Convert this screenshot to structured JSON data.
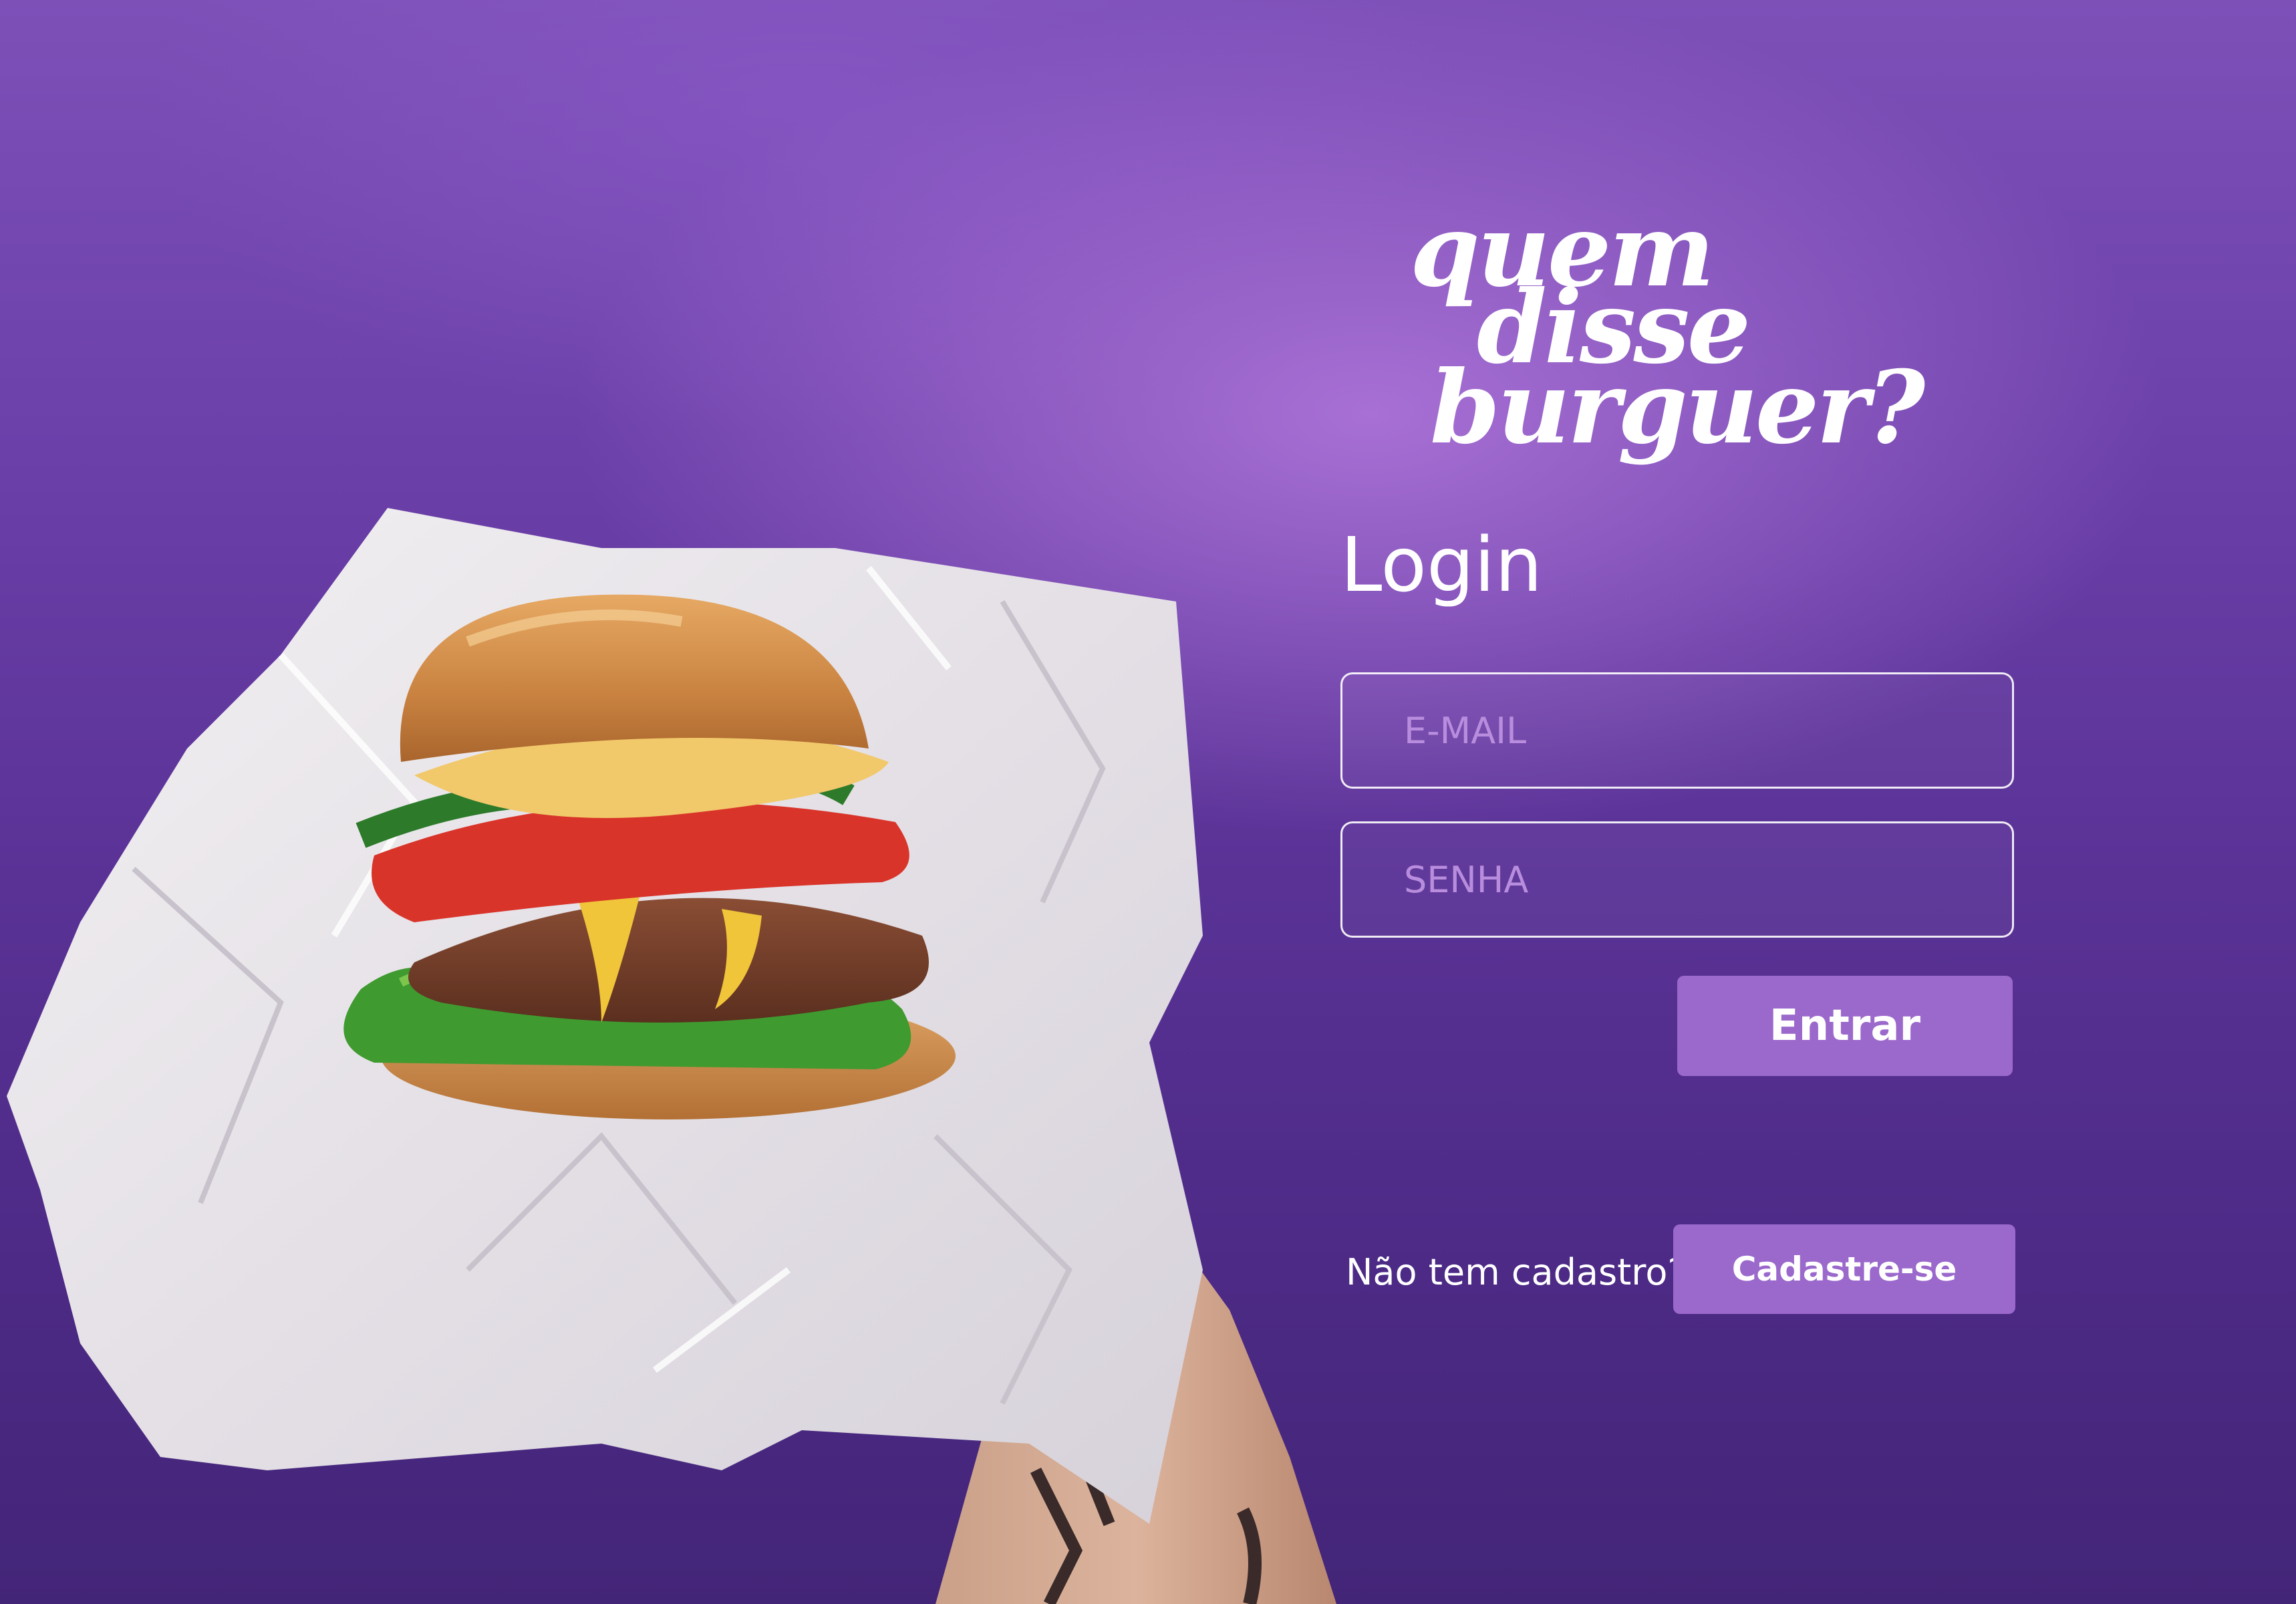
{
  "brand": {
    "line1": "quem",
    "line2": "disse",
    "line3": "burguer?"
  },
  "login": {
    "title": "Login",
    "email_placeholder": "E-MAIL",
    "password_placeholder": "SENHA",
    "submit_label": "Entrar"
  },
  "signup": {
    "prompt": "Não tem cadastro?",
    "button_label": "Cadastre-se"
  },
  "colors": {
    "background": "#5a3296",
    "accent_button": "#9b69cc",
    "placeholder": "#b98ddd",
    "text": "#ffffff"
  }
}
